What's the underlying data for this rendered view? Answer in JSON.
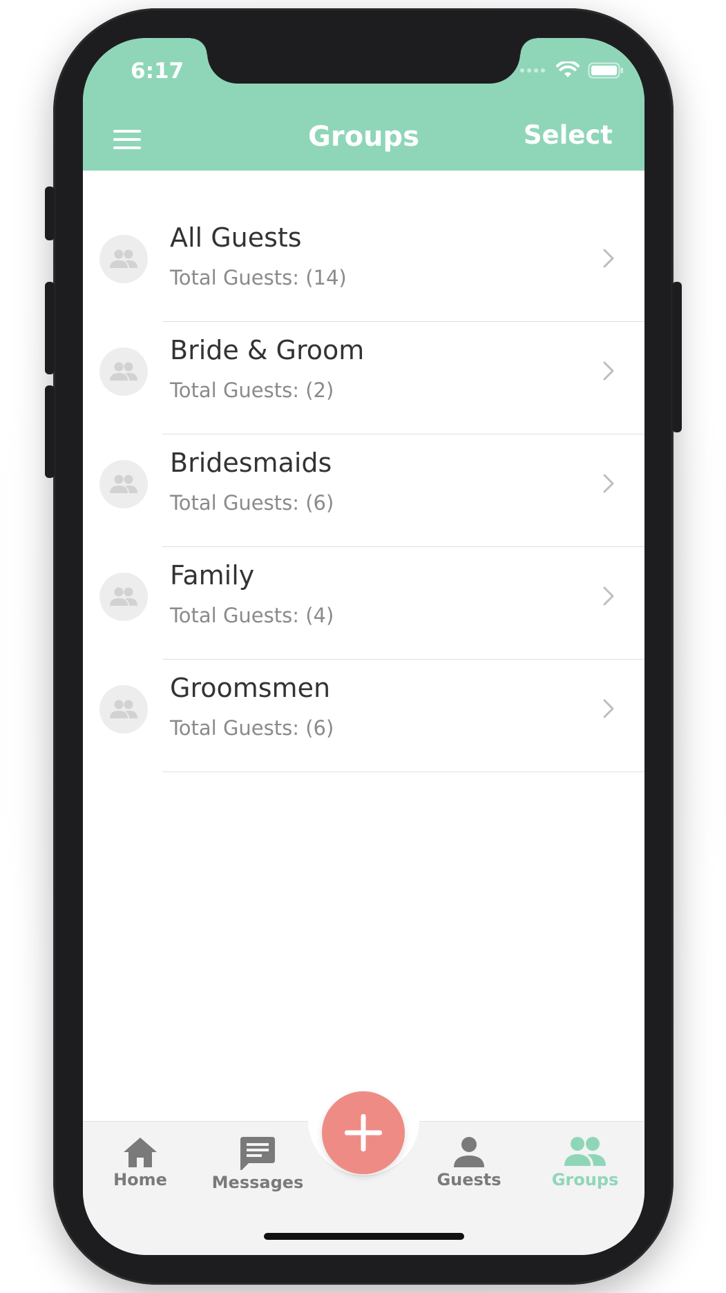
{
  "status_bar": {
    "time": "6:17"
  },
  "header": {
    "title": "Groups",
    "select_label": "Select"
  },
  "groups": [
    {
      "name": "All Guests",
      "subtitle": "Total Guests: (14)"
    },
    {
      "name": "Bride & Groom",
      "subtitle": "Total Guests: (2)"
    },
    {
      "name": "Bridesmaids",
      "subtitle": "Total Guests: (6)"
    },
    {
      "name": "Family",
      "subtitle": "Total Guests: (4)"
    },
    {
      "name": "Groomsmen",
      "subtitle": "Total Guests: (6)"
    }
  ],
  "tabbar": {
    "tabs": [
      {
        "label": "Home",
        "icon": "home-icon"
      },
      {
        "label": "Messages",
        "icon": "message-icon"
      },
      {
        "label": "Guests",
        "icon": "person-icon"
      },
      {
        "label": "Groups",
        "icon": "people-icon",
        "active": true
      }
    ],
    "fab_icon": "plus-icon"
  },
  "colors": {
    "header": "#8fd6b9",
    "accent": "#8fd6b9",
    "fab": "#ef8b85",
    "tab_inactive": "#7a7a7a",
    "tab_active": "#8fd6b9"
  }
}
